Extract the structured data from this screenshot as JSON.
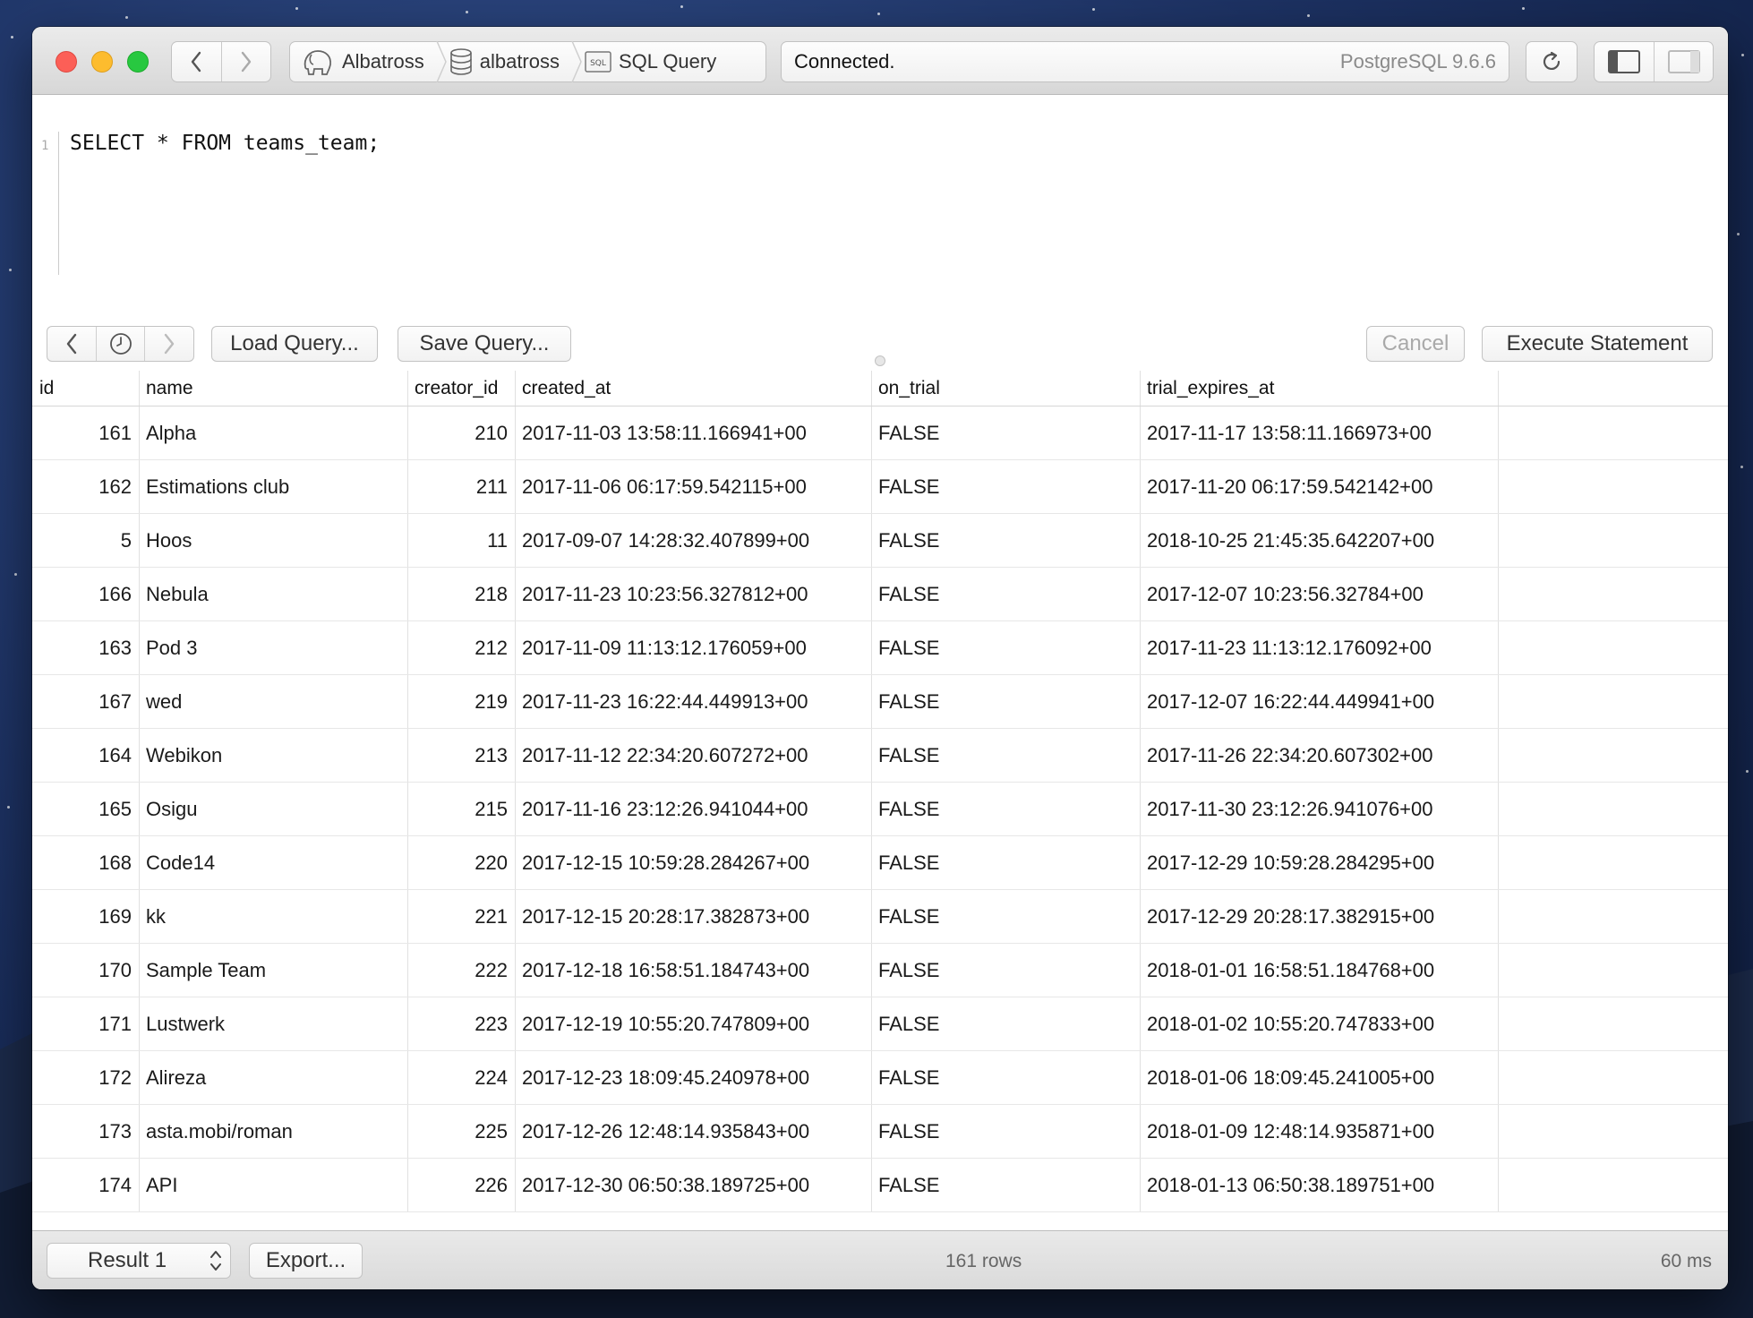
{
  "window": {
    "breadcrumb": [
      "Albatross",
      "albatross",
      "SQL Query"
    ],
    "status": "Connected.",
    "server_version": "PostgreSQL 9.6.6"
  },
  "editor": {
    "line_number": "1",
    "query": "SELECT * FROM teams_team;"
  },
  "toolbar": {
    "load_label": "Load Query...",
    "save_label": "Save Query...",
    "cancel_label": "Cancel",
    "execute_label": "Execute Statement"
  },
  "grid": {
    "columns": [
      "id",
      "name",
      "creator_id",
      "created_at",
      "on_trial",
      "trial_expires_at"
    ],
    "rows": [
      [
        "161",
        "Alpha",
        "210",
        "2017-11-03 13:58:11.166941+00",
        "FALSE",
        "2017-11-17 13:58:11.166973+00"
      ],
      [
        "162",
        "Estimations club",
        "211",
        "2017-11-06 06:17:59.542115+00",
        "FALSE",
        "2017-11-20 06:17:59.542142+00"
      ],
      [
        "5",
        "Hoos",
        "11",
        "2017-09-07 14:28:32.407899+00",
        "FALSE",
        "2018-10-25 21:45:35.642207+00"
      ],
      [
        "166",
        "Nebula",
        "218",
        "2017-11-23 10:23:56.327812+00",
        "FALSE",
        "2017-12-07 10:23:56.32784+00"
      ],
      [
        "163",
        "Pod 3",
        "212",
        "2017-11-09 11:13:12.176059+00",
        "FALSE",
        "2017-11-23 11:13:12.176092+00"
      ],
      [
        "167",
        "wed",
        "219",
        "2017-11-23 16:22:44.449913+00",
        "FALSE",
        "2017-12-07 16:22:44.449941+00"
      ],
      [
        "164",
        "Webikon",
        "213",
        "2017-11-12 22:34:20.607272+00",
        "FALSE",
        "2017-11-26 22:34:20.607302+00"
      ],
      [
        "165",
        "Osigu",
        "215",
        "2017-11-16 23:12:26.941044+00",
        "FALSE",
        "2017-11-30 23:12:26.941076+00"
      ],
      [
        "168",
        "Code14",
        "220",
        "2017-12-15 10:59:28.284267+00",
        "FALSE",
        "2017-12-29 10:59:28.284295+00"
      ],
      [
        "169",
        "kk",
        "221",
        "2017-12-15 20:28:17.382873+00",
        "FALSE",
        "2017-12-29 20:28:17.382915+00"
      ],
      [
        "170",
        "Sample Team",
        "222",
        "2017-12-18 16:58:51.184743+00",
        "FALSE",
        "2018-01-01 16:58:51.184768+00"
      ],
      [
        "171",
        "Lustwerk",
        "223",
        "2017-12-19 10:55:20.747809+00",
        "FALSE",
        "2018-01-02 10:55:20.747833+00"
      ],
      [
        "172",
        "Alireza",
        "224",
        "2017-12-23 18:09:45.240978+00",
        "FALSE",
        "2018-01-06 18:09:45.241005+00"
      ],
      [
        "173",
        "asta.mobi/roman",
        "225",
        "2017-12-26 12:48:14.935843+00",
        "FALSE",
        "2018-01-09 12:48:14.935871+00"
      ],
      [
        "174",
        "API",
        "226",
        "2017-12-30 06:50:38.189725+00",
        "FALSE",
        "2018-01-13 06:50:38.189751+00"
      ]
    ]
  },
  "footer": {
    "result_label": "Result 1",
    "export_label": "Export...",
    "row_count": "161 rows",
    "timing": "60 ms"
  },
  "icons": {
    "back": "chevron-left-icon",
    "forward": "chevron-right-icon",
    "connection": "elephant-icon",
    "database": "database-icon",
    "sql": "sql-icon",
    "refresh": "refresh-icon",
    "history": "clock-icon",
    "left_panel": "left-sidebar-icon",
    "right_panel": "right-sidebar-icon",
    "stepper": "up-down-arrows-icon"
  },
  "colors": {
    "close": "#fc5f57",
    "minimize": "#fdbc2e",
    "maximize": "#28c840"
  }
}
